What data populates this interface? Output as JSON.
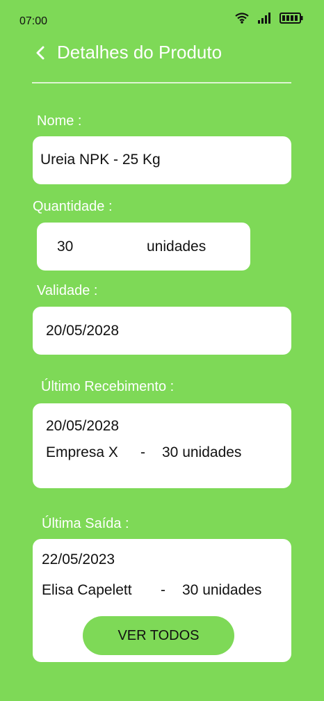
{
  "status_bar": {
    "time": "07:00",
    "icons": [
      "wifi-icon",
      "signal-icon",
      "battery-icon"
    ]
  },
  "header": {
    "back_icon": "chevron-left-icon",
    "title": "Detalhes do Produto"
  },
  "fields": {
    "nome": {
      "label": "Nome :",
      "value": "Ureia NPK - 25 Kg"
    },
    "quantidade": {
      "label": "Quantidade :",
      "value": "30",
      "unit": "unidades"
    },
    "validade": {
      "label": "Validade :",
      "value": "20/05/2028"
    },
    "ultimo_recebimento": {
      "label": "Último Recebimento :",
      "date": "20/05/2028",
      "source": "Empresa X",
      "separator": "-",
      "quantity": "30 unidades"
    },
    "ultima_saida": {
      "label": "Última Saída :",
      "date": "22/05/2023",
      "person": "Elisa Capelett",
      "separator": "-",
      "quantity": "30 unidades",
      "button_label": "VER TODOS"
    }
  },
  "colors": {
    "background": "#7ED957",
    "card": "#FFFFFF",
    "button": "#7ED957"
  }
}
